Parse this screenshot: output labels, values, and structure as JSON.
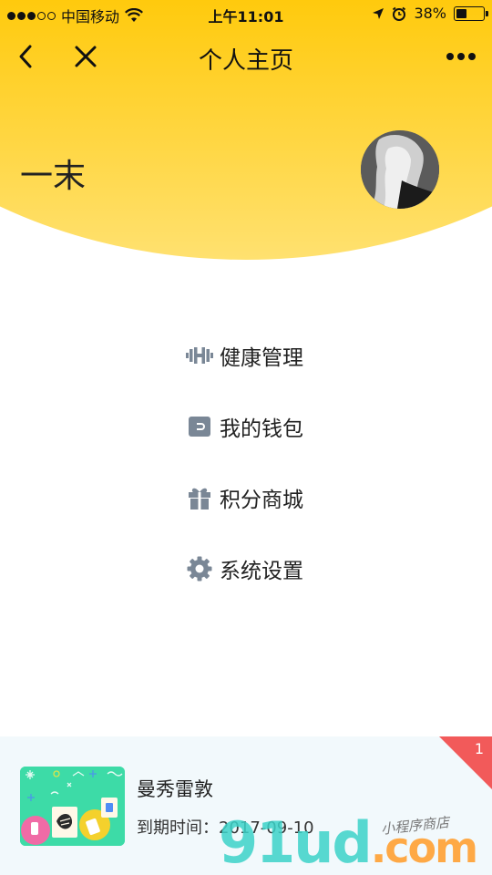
{
  "status_bar": {
    "carrier": "中国移动",
    "time": "上午11:01",
    "battery_percent": "38%",
    "battery_level": 0.38,
    "signal_icon": "signal-dots-icon",
    "wifi_icon": "wifi-icon",
    "location_icon": "location-arrow-icon",
    "alarm_icon": "alarm-clock-icon"
  },
  "navbar": {
    "title": "个人主页",
    "back_icon": "chevron-left-icon",
    "close_icon": "close-icon",
    "more_icon": "more-dots-icon"
  },
  "profile": {
    "name": "一末",
    "avatar": "avatar-photo"
  },
  "menu": {
    "items": [
      {
        "label": "健康管理",
        "icon": "dumbbell-icon"
      },
      {
        "label": "我的钱包",
        "icon": "wallet-icon"
      },
      {
        "label": "积分商城",
        "icon": "gift-icon"
      },
      {
        "label": "系统设置",
        "icon": "gear-icon"
      }
    ]
  },
  "card": {
    "title": "曼秀雷敦",
    "expiry": "到期时间：2017-09-10",
    "badge": "1"
  },
  "watermark": {
    "main": "91ud",
    "suffix": ".com",
    "tagline": "小程序商店"
  },
  "colors": {
    "banner": "#FFC300",
    "icon_gray": "#7A8796",
    "card_bg": "#F2F9FC",
    "badge": "#F25A5A",
    "thumb": "#3DDBA7"
  }
}
